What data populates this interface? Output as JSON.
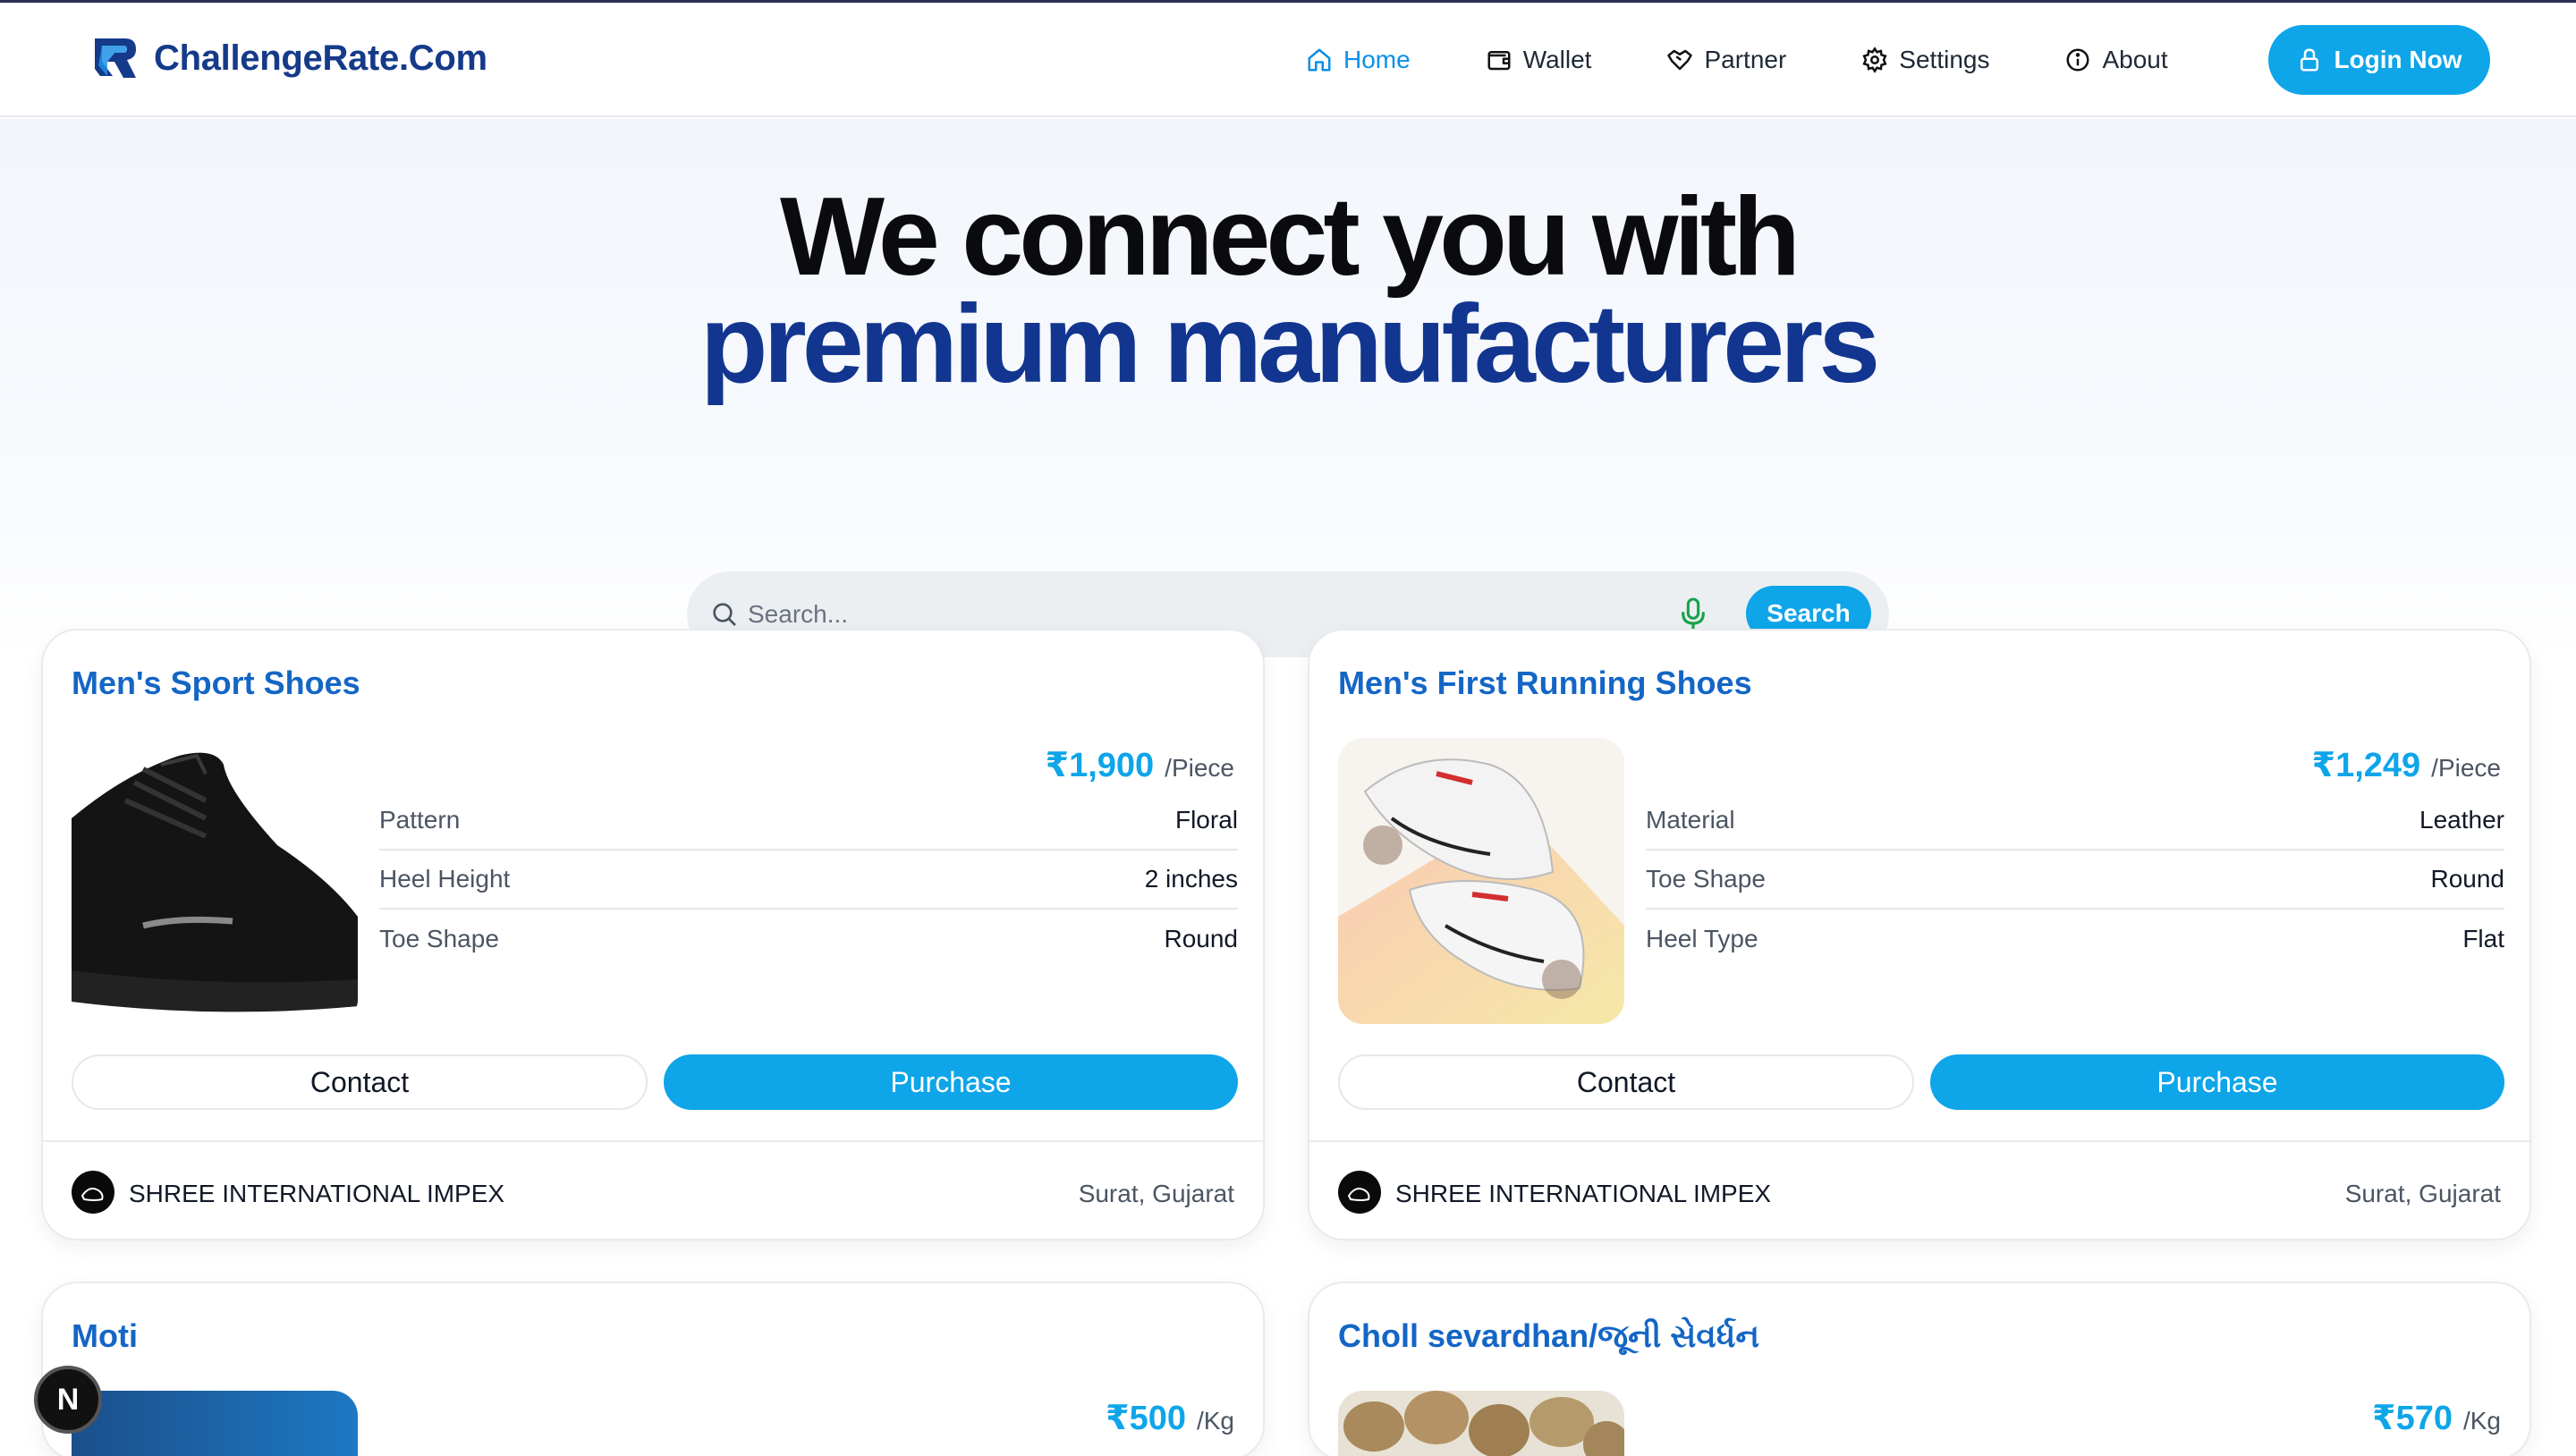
{
  "header": {
    "brand": "ChallengeRate.Com",
    "nav": [
      {
        "label": "Home",
        "icon": "home-icon",
        "active": true
      },
      {
        "label": "Wallet",
        "icon": "wallet-icon"
      },
      {
        "label": "Partner",
        "icon": "handshake-icon"
      },
      {
        "label": "Settings",
        "icon": "gear-icon"
      },
      {
        "label": "About",
        "icon": "info-icon"
      }
    ],
    "login_label": "Login Now"
  },
  "hero": {
    "line1": "We connect you with",
    "line2": "premium manufacturers"
  },
  "search": {
    "placeholder": "Search...",
    "button_label": "Search"
  },
  "colors": {
    "accent": "#0ea5e9",
    "brand": "#153a8a",
    "title": "#1466c5"
  },
  "products": [
    {
      "title": "Men's Sport Shoes",
      "price": "₹1,900",
      "unit": "/Piece",
      "attributes": [
        {
          "key": "Pattern",
          "value": "Floral"
        },
        {
          "key": "Heel Height",
          "value": "2 inches"
        },
        {
          "key": "Toe Shape",
          "value": "Round"
        }
      ],
      "contact_label": "Contact",
      "purchase_label": "Purchase",
      "seller": "SHREE INTERNATIONAL IMPEX",
      "location": "Surat, Gujarat"
    },
    {
      "title": "Men's First Running Shoes",
      "price": "₹1,249",
      "unit": "/Piece",
      "attributes": [
        {
          "key": "Material",
          "value": "Leather"
        },
        {
          "key": "Toe Shape",
          "value": "Round"
        },
        {
          "key": "Heel Type",
          "value": "Flat"
        }
      ],
      "contact_label": "Contact",
      "purchase_label": "Purchase",
      "seller": "SHREE INTERNATIONAL IMPEX",
      "location": "Surat, Gujarat"
    },
    {
      "title": "Moti",
      "price": "₹500",
      "unit": "/Kg"
    },
    {
      "title": "Choll sevardhan/જૂની સેવર્ધન",
      "price": "₹570",
      "unit": "/Kg"
    }
  ],
  "dev_badge": "N"
}
